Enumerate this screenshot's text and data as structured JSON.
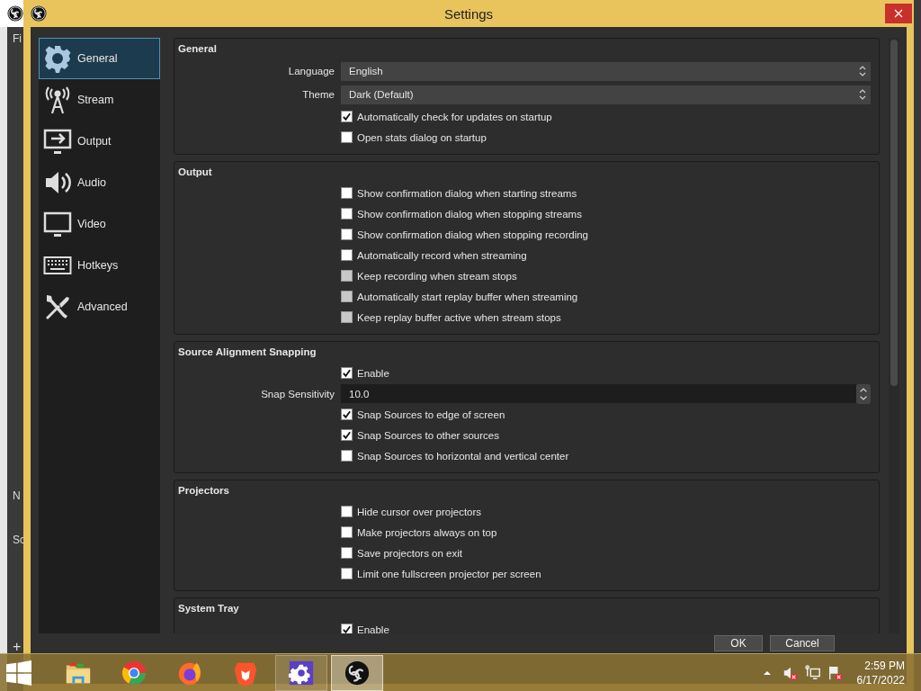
{
  "main_window": {
    "menu_item": "Fi",
    "panel_1_title": "N",
    "panel_2_title": "Sc",
    "add_button": "+"
  },
  "window": {
    "title": "Settings"
  },
  "sidebar": {
    "items": [
      {
        "label": "General",
        "selected": true
      },
      {
        "label": "Stream",
        "selected": false
      },
      {
        "label": "Output",
        "selected": false
      },
      {
        "label": "Audio",
        "selected": false
      },
      {
        "label": "Video",
        "selected": false
      },
      {
        "label": "Hotkeys",
        "selected": false
      },
      {
        "label": "Advanced",
        "selected": false
      }
    ]
  },
  "sections": [
    {
      "title": "General",
      "rows": [
        {
          "kind": "select",
          "label": "Language",
          "value": "English"
        },
        {
          "kind": "select",
          "label": "Theme",
          "value": "Dark (Default)"
        },
        {
          "kind": "checkbox",
          "label": "Automatically check for updates on startup",
          "checked": true,
          "disabled": false
        },
        {
          "kind": "checkbox",
          "label": "Open stats dialog on startup",
          "checked": false,
          "disabled": false
        }
      ]
    },
    {
      "title": "Output",
      "rows": [
        {
          "kind": "checkbox",
          "label": "Show confirmation dialog when starting streams",
          "checked": false,
          "disabled": false
        },
        {
          "kind": "checkbox",
          "label": "Show confirmation dialog when stopping streams",
          "checked": false,
          "disabled": false
        },
        {
          "kind": "checkbox",
          "label": "Show confirmation dialog when stopping recording",
          "checked": false,
          "disabled": false
        },
        {
          "kind": "checkbox",
          "label": "Automatically record when streaming",
          "checked": false,
          "disabled": false
        },
        {
          "kind": "checkbox",
          "label": "Keep recording when stream stops",
          "checked": false,
          "disabled": true
        },
        {
          "kind": "checkbox",
          "label": "Automatically start replay buffer when streaming",
          "checked": false,
          "disabled": true
        },
        {
          "kind": "checkbox",
          "label": "Keep replay buffer active when stream stops",
          "checked": false,
          "disabled": true
        }
      ]
    },
    {
      "title": "Source Alignment Snapping",
      "rows": [
        {
          "kind": "checkbox",
          "label": "Enable",
          "checked": true,
          "disabled": false
        },
        {
          "kind": "spin",
          "label": "Snap Sensitivity",
          "value": "10.0"
        },
        {
          "kind": "checkbox",
          "label": "Snap Sources to edge of screen",
          "checked": true,
          "disabled": false
        },
        {
          "kind": "checkbox",
          "label": "Snap Sources to other sources",
          "checked": true,
          "disabled": false
        },
        {
          "kind": "checkbox",
          "label": "Snap Sources to horizontal and vertical center",
          "checked": false,
          "disabled": false
        }
      ]
    },
    {
      "title": "Projectors",
      "rows": [
        {
          "kind": "checkbox",
          "label": "Hide cursor over projectors",
          "checked": false,
          "disabled": false
        },
        {
          "kind": "checkbox",
          "label": "Make projectors always on top",
          "checked": false,
          "disabled": false
        },
        {
          "kind": "checkbox",
          "label": "Save projectors on exit",
          "checked": false,
          "disabled": false
        },
        {
          "kind": "checkbox",
          "label": "Limit one fullscreen projector per screen",
          "checked": false,
          "disabled": false
        }
      ]
    },
    {
      "title": "System Tray",
      "rows": [
        {
          "kind": "checkbox",
          "label": "Enable",
          "checked": true,
          "disabled": false
        }
      ]
    }
  ],
  "buttons": [
    "OK",
    "Cancel"
  ],
  "taskbar": {
    "apps": [
      {
        "open": false,
        "selected": false
      },
      {
        "open": false,
        "selected": false
      },
      {
        "open": false,
        "selected": false
      },
      {
        "open": false,
        "selected": false
      },
      {
        "open": true,
        "selected": false
      },
      {
        "open": true,
        "selected": true
      }
    ],
    "clock": {
      "time": "2:59 PM",
      "date": "6/17/2022"
    }
  }
}
